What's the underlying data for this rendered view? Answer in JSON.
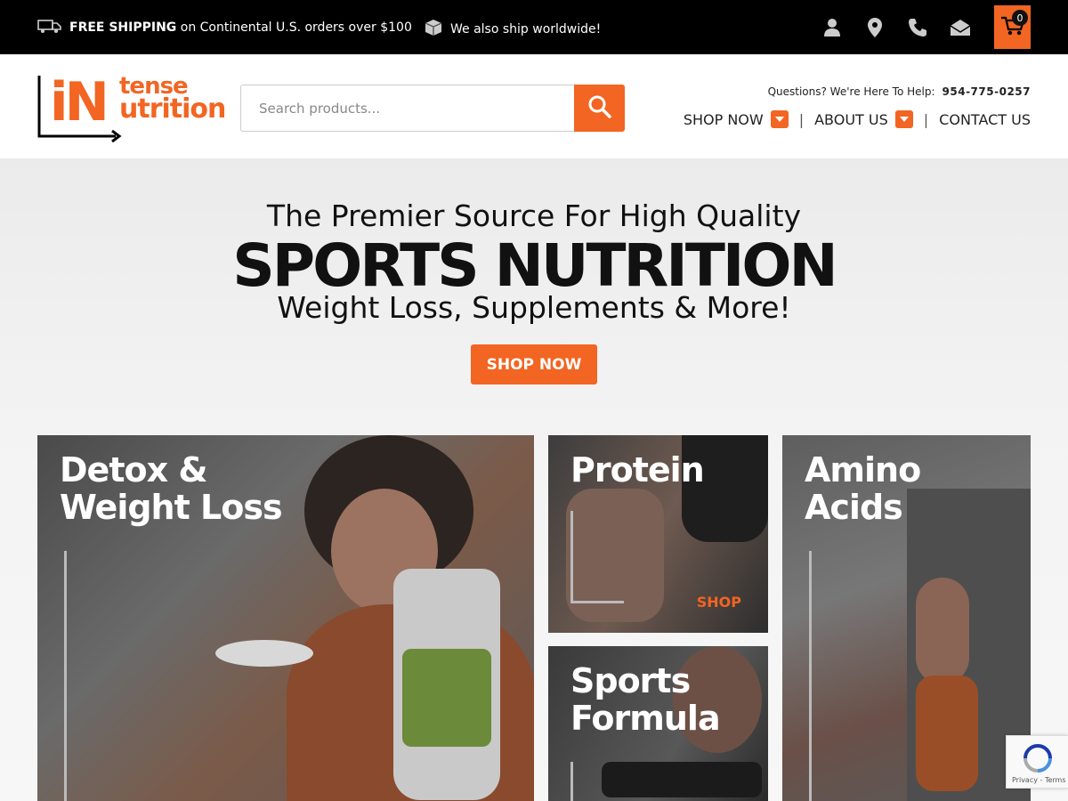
{
  "topbar": {
    "shipping_bold": "FREE SHIPPING",
    "shipping_rest": " on Continental U.S. orders over $100",
    "worldwide": "We also ship worldwide!",
    "cart_count": "0",
    "icons": [
      "truck-icon",
      "package-icon",
      "user-icon",
      "location-pin-icon",
      "phone-icon",
      "mail-icon",
      "cart-icon"
    ]
  },
  "header": {
    "logo_in": "iN",
    "logo_tense": "tense",
    "logo_utrition": "utrition",
    "search_placeholder": "Search products...",
    "help_label": "Questions? We're Here To Help:",
    "help_phone": "954-775-0257",
    "nav": {
      "shop_now": "SHOP NOW",
      "about_us": "ABOUT US",
      "contact_us": "CONTACT US",
      "separator": "|"
    }
  },
  "hero": {
    "line1": "The Premier Source For High Quality",
    "line2": "SPORTS NUTRITION",
    "line3": "Weight Loss, Supplements & More!",
    "cta": "SHOP NOW"
  },
  "tiles": {
    "detox": "Detox &\nWeight Loss",
    "protein": "Protein",
    "protein_shop": "SHOP",
    "sports": "Sports\nFormula",
    "amino": "Amino\nAcids"
  },
  "recaptcha": {
    "links": "Privacy - Terms"
  },
  "colors": {
    "accent": "#f26522",
    "topbar": "#000000"
  }
}
